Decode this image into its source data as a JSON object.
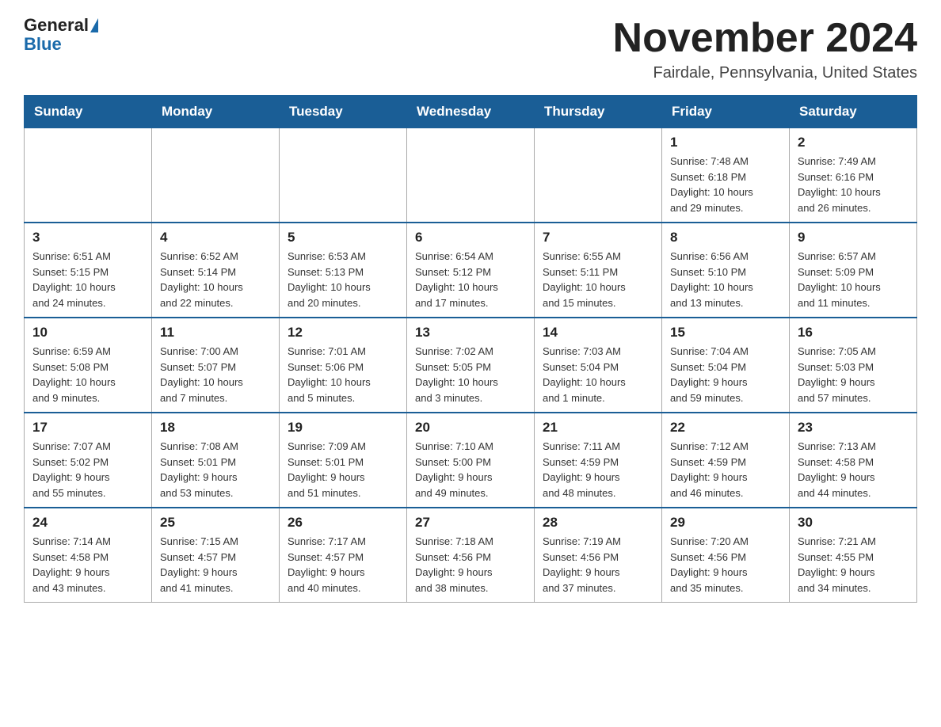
{
  "header": {
    "logo_general": "General",
    "logo_blue": "Blue",
    "month_title": "November 2024",
    "location": "Fairdale, Pennsylvania, United States"
  },
  "weekdays": [
    "Sunday",
    "Monday",
    "Tuesday",
    "Wednesday",
    "Thursday",
    "Friday",
    "Saturday"
  ],
  "weeks": [
    [
      {
        "day": "",
        "info": ""
      },
      {
        "day": "",
        "info": ""
      },
      {
        "day": "",
        "info": ""
      },
      {
        "day": "",
        "info": ""
      },
      {
        "day": "",
        "info": ""
      },
      {
        "day": "1",
        "info": "Sunrise: 7:48 AM\nSunset: 6:18 PM\nDaylight: 10 hours\nand 29 minutes."
      },
      {
        "day": "2",
        "info": "Sunrise: 7:49 AM\nSunset: 6:16 PM\nDaylight: 10 hours\nand 26 minutes."
      }
    ],
    [
      {
        "day": "3",
        "info": "Sunrise: 6:51 AM\nSunset: 5:15 PM\nDaylight: 10 hours\nand 24 minutes."
      },
      {
        "day": "4",
        "info": "Sunrise: 6:52 AM\nSunset: 5:14 PM\nDaylight: 10 hours\nand 22 minutes."
      },
      {
        "day": "5",
        "info": "Sunrise: 6:53 AM\nSunset: 5:13 PM\nDaylight: 10 hours\nand 20 minutes."
      },
      {
        "day": "6",
        "info": "Sunrise: 6:54 AM\nSunset: 5:12 PM\nDaylight: 10 hours\nand 17 minutes."
      },
      {
        "day": "7",
        "info": "Sunrise: 6:55 AM\nSunset: 5:11 PM\nDaylight: 10 hours\nand 15 minutes."
      },
      {
        "day": "8",
        "info": "Sunrise: 6:56 AM\nSunset: 5:10 PM\nDaylight: 10 hours\nand 13 minutes."
      },
      {
        "day": "9",
        "info": "Sunrise: 6:57 AM\nSunset: 5:09 PM\nDaylight: 10 hours\nand 11 minutes."
      }
    ],
    [
      {
        "day": "10",
        "info": "Sunrise: 6:59 AM\nSunset: 5:08 PM\nDaylight: 10 hours\nand 9 minutes."
      },
      {
        "day": "11",
        "info": "Sunrise: 7:00 AM\nSunset: 5:07 PM\nDaylight: 10 hours\nand 7 minutes."
      },
      {
        "day": "12",
        "info": "Sunrise: 7:01 AM\nSunset: 5:06 PM\nDaylight: 10 hours\nand 5 minutes."
      },
      {
        "day": "13",
        "info": "Sunrise: 7:02 AM\nSunset: 5:05 PM\nDaylight: 10 hours\nand 3 minutes."
      },
      {
        "day": "14",
        "info": "Sunrise: 7:03 AM\nSunset: 5:04 PM\nDaylight: 10 hours\nand 1 minute."
      },
      {
        "day": "15",
        "info": "Sunrise: 7:04 AM\nSunset: 5:04 PM\nDaylight: 9 hours\nand 59 minutes."
      },
      {
        "day": "16",
        "info": "Sunrise: 7:05 AM\nSunset: 5:03 PM\nDaylight: 9 hours\nand 57 minutes."
      }
    ],
    [
      {
        "day": "17",
        "info": "Sunrise: 7:07 AM\nSunset: 5:02 PM\nDaylight: 9 hours\nand 55 minutes."
      },
      {
        "day": "18",
        "info": "Sunrise: 7:08 AM\nSunset: 5:01 PM\nDaylight: 9 hours\nand 53 minutes."
      },
      {
        "day": "19",
        "info": "Sunrise: 7:09 AM\nSunset: 5:01 PM\nDaylight: 9 hours\nand 51 minutes."
      },
      {
        "day": "20",
        "info": "Sunrise: 7:10 AM\nSunset: 5:00 PM\nDaylight: 9 hours\nand 49 minutes."
      },
      {
        "day": "21",
        "info": "Sunrise: 7:11 AM\nSunset: 4:59 PM\nDaylight: 9 hours\nand 48 minutes."
      },
      {
        "day": "22",
        "info": "Sunrise: 7:12 AM\nSunset: 4:59 PM\nDaylight: 9 hours\nand 46 minutes."
      },
      {
        "day": "23",
        "info": "Sunrise: 7:13 AM\nSunset: 4:58 PM\nDaylight: 9 hours\nand 44 minutes."
      }
    ],
    [
      {
        "day": "24",
        "info": "Sunrise: 7:14 AM\nSunset: 4:58 PM\nDaylight: 9 hours\nand 43 minutes."
      },
      {
        "day": "25",
        "info": "Sunrise: 7:15 AM\nSunset: 4:57 PM\nDaylight: 9 hours\nand 41 minutes."
      },
      {
        "day": "26",
        "info": "Sunrise: 7:17 AM\nSunset: 4:57 PM\nDaylight: 9 hours\nand 40 minutes."
      },
      {
        "day": "27",
        "info": "Sunrise: 7:18 AM\nSunset: 4:56 PM\nDaylight: 9 hours\nand 38 minutes."
      },
      {
        "day": "28",
        "info": "Sunrise: 7:19 AM\nSunset: 4:56 PM\nDaylight: 9 hours\nand 37 minutes."
      },
      {
        "day": "29",
        "info": "Sunrise: 7:20 AM\nSunset: 4:56 PM\nDaylight: 9 hours\nand 35 minutes."
      },
      {
        "day": "30",
        "info": "Sunrise: 7:21 AM\nSunset: 4:55 PM\nDaylight: 9 hours\nand 34 minutes."
      }
    ]
  ]
}
